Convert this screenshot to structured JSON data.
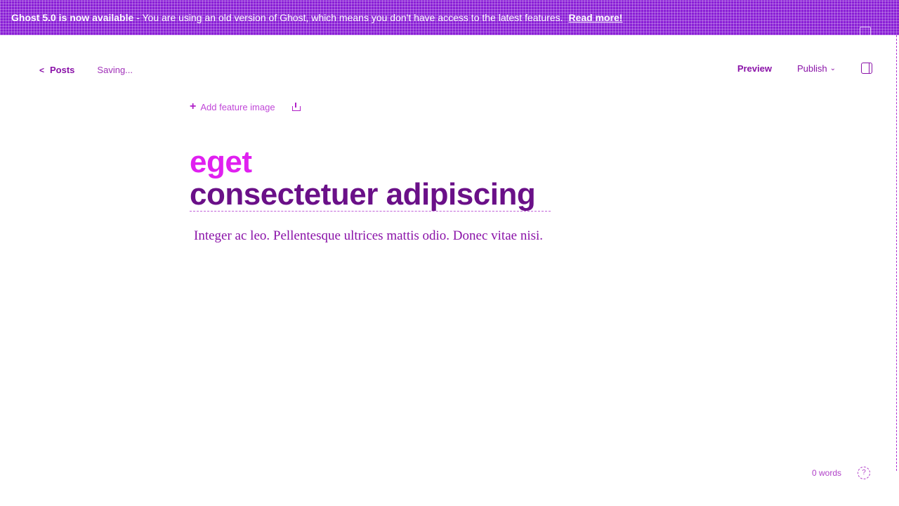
{
  "banner": {
    "headline": "Ghost 5.0 is now available",
    "message": "- You are using an old version of Ghost, which means you don't have access to the latest features.",
    "link_label": "Read more!"
  },
  "toolbar": {
    "back_label": "Posts",
    "status": "Saving...",
    "preview_label": "Preview",
    "publish_label": "Publish"
  },
  "editor": {
    "feature_image_label": "Add feature image",
    "title_line1": "eget",
    "title_line2": "consectetuer adipiscing",
    "body": "Integer ac leo. Pellentesque ultrices mattis odio. Donec vitae nisi."
  },
  "footer": {
    "word_count": "0 words"
  }
}
